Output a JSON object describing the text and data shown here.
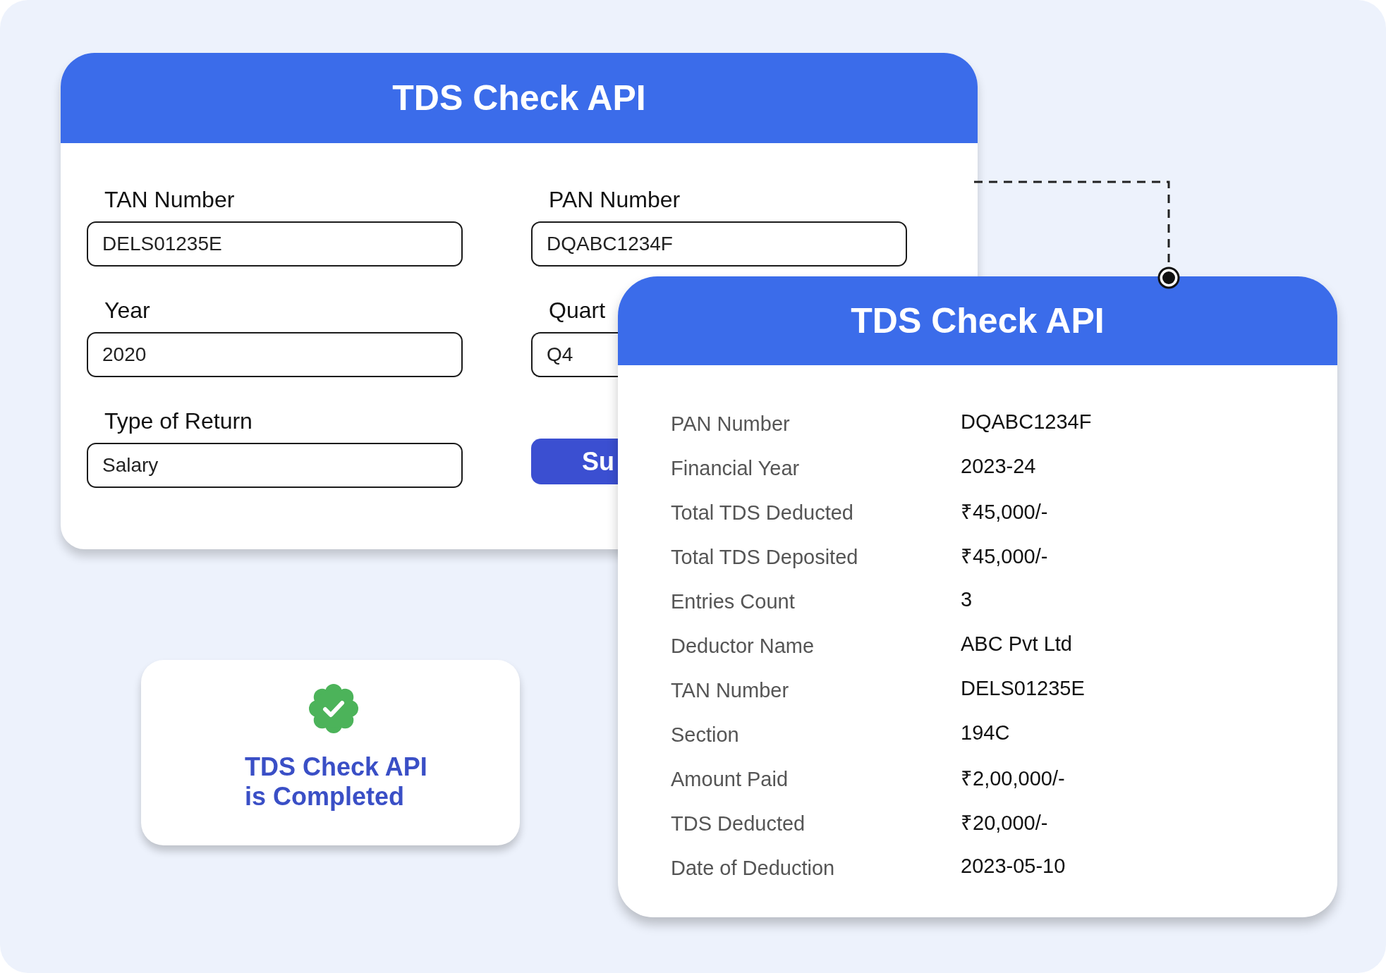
{
  "form_card": {
    "title": "TDS Check API",
    "fields": [
      {
        "label": "TAN Number",
        "value": "DELS01235E"
      },
      {
        "label": "PAN Number",
        "value": "DQABC1234F"
      },
      {
        "label": "Year",
        "value": "2020"
      },
      {
        "label": "Quart",
        "value": "Q4"
      },
      {
        "label": "Type of Return",
        "value": "Salary"
      }
    ],
    "submit_button": "Su"
  },
  "result_card": {
    "title": "TDS Check API",
    "rows": [
      {
        "label": "PAN Number",
        "value": "DQABC1234F"
      },
      {
        "label": "Financial Year",
        "value": "2023-24"
      },
      {
        "label": "Total TDS Deducted",
        "value": "₹45,000/-"
      },
      {
        "label": "Total TDS Deposited",
        "value": "₹45,000/-"
      },
      {
        "label": "Entries Count",
        "value": "3"
      },
      {
        "label": "Deductor Name",
        "value": "ABC Pvt Ltd"
      },
      {
        "label": "TAN Number",
        "value": "DELS01235E"
      },
      {
        "label": "Section",
        "value": "194C"
      },
      {
        "label": "Amount Paid",
        "value": "₹2,00,000/-"
      },
      {
        "label": "TDS Deducted",
        "value": "₹20,000/-"
      },
      {
        "label": "Date of Deduction",
        "value": "2023-05-10"
      }
    ]
  },
  "status_card": {
    "lines": [
      "TDS Check API",
      "is Completed"
    ]
  }
}
